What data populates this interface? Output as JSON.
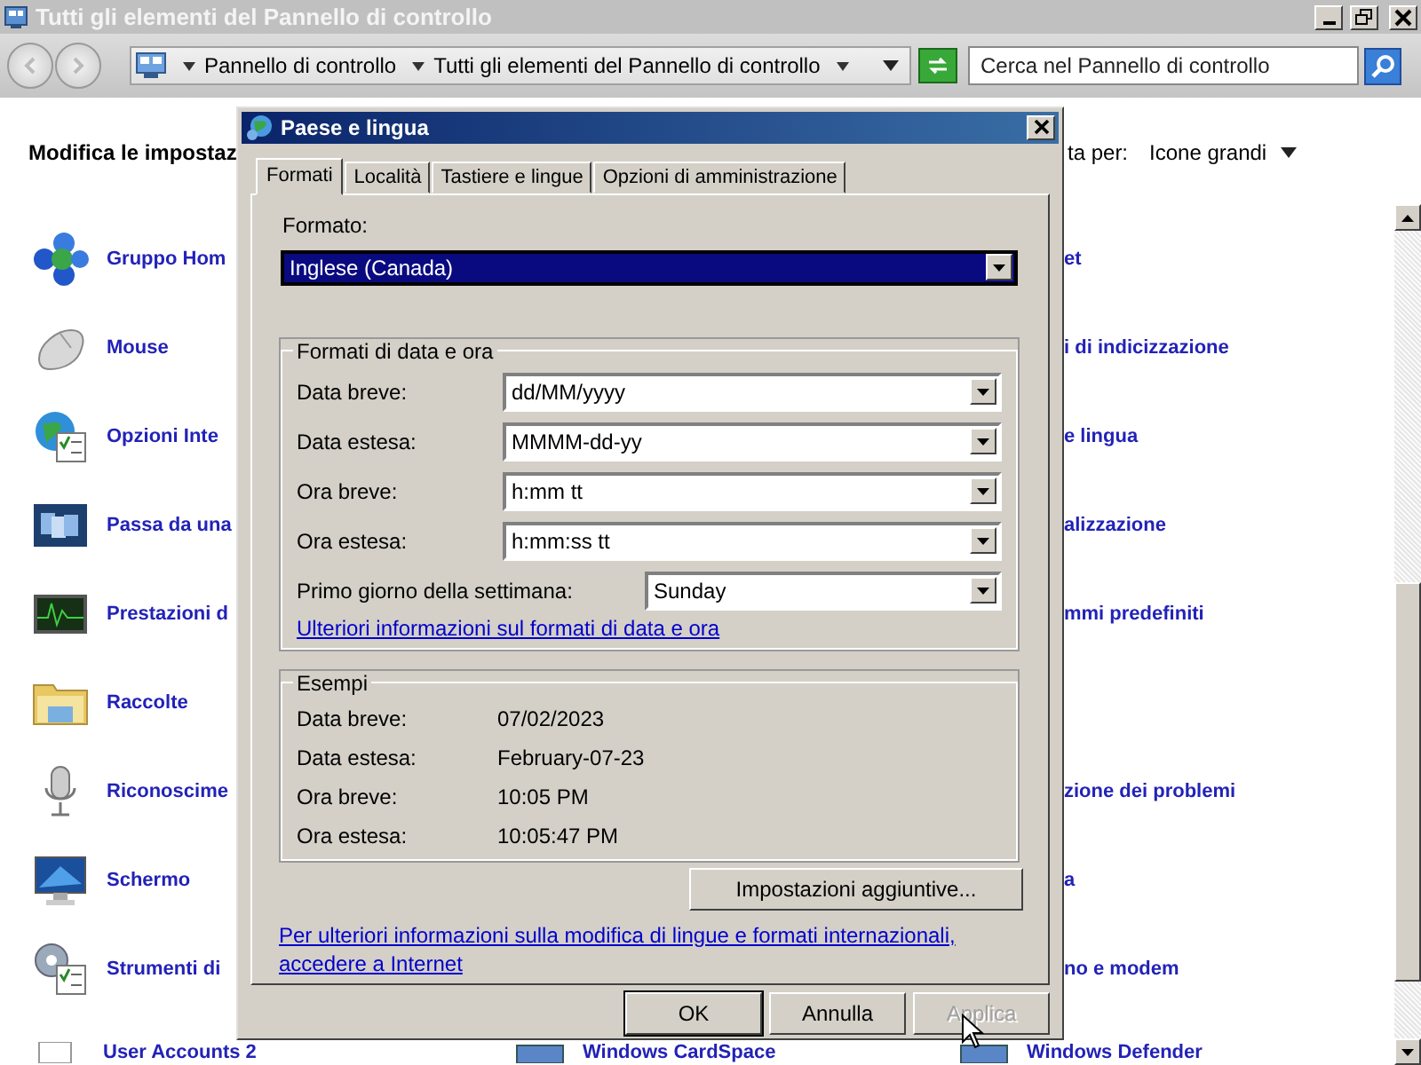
{
  "window": {
    "title": "Tutti gli elementi del Pannello di controllo"
  },
  "address_bar": {
    "breadcrumbs": [
      "Pannello di controllo",
      "Tutti gli elementi del Pannello di controllo"
    ]
  },
  "search": {
    "placeholder": "Cerca nel Pannello di controllo"
  },
  "content": {
    "heading": "Modifica le impostaz",
    "view_label": "ta per:",
    "view_value": "Icone grandi",
    "rows": [
      {
        "left": "Gruppo Hom",
        "right": "et"
      },
      {
        "left": "Mouse",
        "right": "i di indicizzazione"
      },
      {
        "left": "Opzioni Inte",
        "right": "e lingua"
      },
      {
        "left": "Passa da una",
        "right": "alizzazione"
      },
      {
        "left": "Prestazioni d",
        "right": "mmi predefiniti"
      },
      {
        "left": "Raccolte"
      },
      {
        "left": "Riconoscime",
        "right": "zione dei problemi"
      },
      {
        "left": "Schermo",
        "right": "a"
      },
      {
        "left": "Strumenti di",
        "right": "no e modem"
      }
    ],
    "bottom_row": [
      "User Accounts 2",
      "Windows CardSpace",
      "Windows Defender"
    ]
  },
  "dialog": {
    "title": "Paese e lingua",
    "tabs": [
      {
        "label": "Formati",
        "selected": true
      },
      {
        "label": "Località",
        "selected": false
      },
      {
        "label": "Tastiere e lingue",
        "selected": false
      },
      {
        "label": "Opzioni di amministrazione",
        "selected": false
      }
    ],
    "format_label": "Formato:",
    "format_value": "Inglese (Canada)",
    "formats_group": {
      "title": "Formati di data e ora",
      "fields": [
        {
          "label": "Data breve:",
          "value": "dd/MM/yyyy"
        },
        {
          "label": "Data estesa:",
          "value": "MMMM-dd-yy"
        },
        {
          "label": "Ora breve:",
          "value": "h:mm tt"
        },
        {
          "label": "Ora estesa:",
          "value": "h:mm:ss tt"
        }
      ],
      "first_day": {
        "label": "Primo giorno della settimana:",
        "value": "Sunday"
      },
      "link": "Ulteriori informazioni sul formati di data e ora"
    },
    "examples": {
      "title": "Esempi",
      "rows": [
        {
          "label": "Data breve:",
          "value": "07/02/2023"
        },
        {
          "label": "Data estesa:",
          "value": "February-07-23"
        },
        {
          "label": "Ora breve:",
          "value": "10:05 PM"
        },
        {
          "label": "Ora estesa:",
          "value": "10:05:47 PM"
        }
      ]
    },
    "additional_button": "Impostazioni aggiuntive...",
    "footer_link": "Per ulteriori informazioni sulla modifica di lingue e formati internazionali, accedere a Internet",
    "buttons": [
      {
        "label": "OK",
        "default": true,
        "disabled": false
      },
      {
        "label": "Annulla",
        "default": false,
        "disabled": false
      },
      {
        "label": "Applica",
        "default": false,
        "disabled": true
      }
    ]
  }
}
